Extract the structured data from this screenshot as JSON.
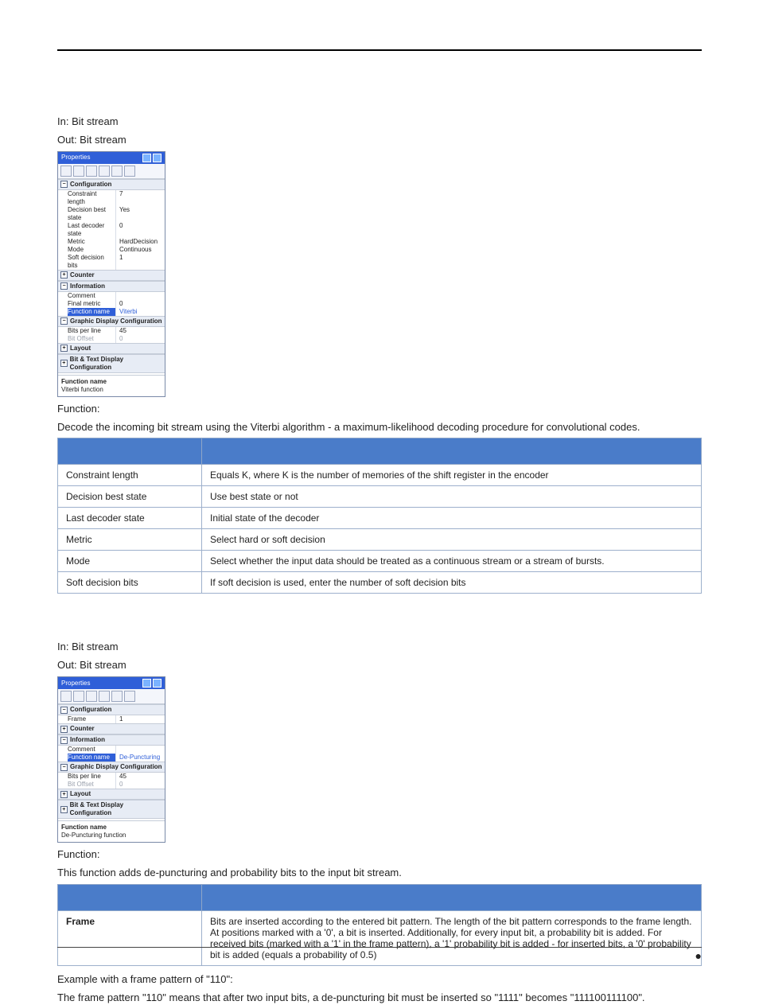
{
  "section1": {
    "in": "In: Bit stream",
    "out": "Out: Bit stream",
    "funcLabel": "Function:",
    "funcDesc": "Decode the incoming bit stream using the Viterbi algorithm - a maximum-likelihood decoding procedure for convolutional codes.",
    "panel": {
      "title": "Properties",
      "groups": {
        "config": {
          "label": "Configuration",
          "rows": [
            [
              "Constraint length",
              "7"
            ],
            [
              "Decision best state",
              "Yes"
            ],
            [
              "Last decoder state",
              "0"
            ],
            [
              "Metric",
              "HardDecision"
            ],
            [
              "Mode",
              "Continuous"
            ],
            [
              "Soft decision bits",
              "1"
            ]
          ]
        },
        "counter": {
          "label": "Counter"
        },
        "info": {
          "label": "Information",
          "rows": [
            [
              "Comment",
              ""
            ],
            [
              "Final metric",
              "0"
            ]
          ],
          "selected": [
            "Function name",
            "Viterbi"
          ]
        },
        "gdc": {
          "label": "Graphic Display Configuration",
          "rows": [
            [
              "Bits per line",
              "45"
            ]
          ],
          "dim": [
            "Bit Offset",
            "0"
          ]
        },
        "layout": {
          "label": "Layout"
        },
        "btdc": {
          "label": "Bit & Text Display Configuration"
        }
      },
      "footerTitle": "Function name",
      "footerDesc": "Viterbi function"
    },
    "table": [
      [
        "Constraint length",
        "Equals K, where K is the number of memories of the shift register in the encoder"
      ],
      [
        "Decision best state",
        "Use best state or not"
      ],
      [
        "Last decoder state",
        "Initial state of the decoder"
      ],
      [
        "Metric",
        "Select hard or soft decision"
      ],
      [
        "Mode",
        "Select whether the input data should be treated as a continuous stream or a stream of bursts."
      ],
      [
        "Soft decision bits",
        "If soft decision is used, enter the number of soft decision bits"
      ]
    ]
  },
  "section2": {
    "in": "In: Bit stream",
    "out": "Out: Bit stream",
    "funcLabel": "Function:",
    "funcDesc": "This function adds de-puncturing and probability bits to the input bit stream.",
    "panel": {
      "title": "Properties",
      "groups": {
        "config": {
          "label": "Configuration",
          "rows": [
            [
              "Frame",
              "1"
            ]
          ]
        },
        "counter": {
          "label": "Counter"
        },
        "info": {
          "label": "Information",
          "rows": [
            [
              "Comment",
              ""
            ]
          ],
          "selected": [
            "Function name",
            "De-Puncturing"
          ]
        },
        "gdc": {
          "label": "Graphic Display Configuration",
          "rows": [
            [
              "Bits per line",
              "45"
            ]
          ],
          "dim": [
            "Bit Offset",
            "0"
          ]
        },
        "layout": {
          "label": "Layout"
        },
        "btdc": {
          "label": "Bit & Text Display Configuration"
        }
      },
      "footerTitle": "Function name",
      "footerDesc": "De-Puncturing function"
    },
    "table": [
      [
        "Frame",
        "Bits are inserted according to the entered bit pattern. The length of the bit pattern corresponds to the frame length. At positions marked with a '0', a bit is inserted. Additionally, for every input bit, a probability bit is added. For received bits (marked with a '1' in the frame pattern), a '1' probability bit is added - for inserted bits, a '0' probability bit is added (equals a probability of 0.5)"
      ]
    ],
    "exampleHeading": "Example with a frame pattern of \"110\":",
    "exampleBody": "The frame pattern \"110\" means that after two input bits, a de-puncturing bit must be inserted so \"1111\" becomes \"111100111100\"."
  },
  "bot": {
    "bullet": "●"
  }
}
